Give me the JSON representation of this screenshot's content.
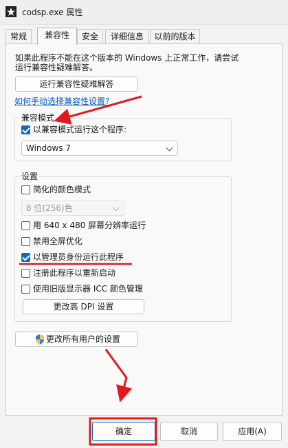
{
  "window": {
    "title": "codsp.exe 属性",
    "app_icon": "star-icon"
  },
  "tabs": [
    {
      "label": "常规"
    },
    {
      "label": "兼容性",
      "active": true
    },
    {
      "label": "安全"
    },
    {
      "label": "详细信息"
    },
    {
      "label": "以前的版本"
    }
  ],
  "intro": {
    "line1": "如果此程序不能在这个版本的 Windows 上正常工作，请尝试",
    "line2": "运行兼容性疑难解答。"
  },
  "troubleshooter_button": "运行兼容性疑难解答",
  "manual_link": "如何手动选择兼容性设置?",
  "compat_mode": {
    "group_label": "兼容模式",
    "checkbox_label": "以兼容模式运行这个程序:",
    "checked": true,
    "selected_os": "Windows 7"
  },
  "settings": {
    "group_label": "设置",
    "reduced_color": {
      "label": "简化的颜色模式",
      "checked": false
    },
    "color_select": "8 位(256)色",
    "res_640": {
      "label": "用 640 x 480 屏幕分辨率运行",
      "checked": false
    },
    "disable_fullscreen": {
      "label": "禁用全屏优化",
      "checked": false
    },
    "run_as_admin": {
      "label": "以管理员身份运行此程序",
      "checked": true
    },
    "register_restart": {
      "label": "注册此程序以重新启动",
      "checked": false
    },
    "legacy_icc": {
      "label": "使用旧版显示器 ICC 颜色管理",
      "checked": false
    },
    "dpi_button": "更改高 DPI 设置"
  },
  "all_users_button": "更改所有用户的设置",
  "all_users_icon": "shield-icon",
  "footer": {
    "ok": "确定",
    "cancel": "取消",
    "apply": "应用(A)"
  },
  "annotation_color": "#e0191c",
  "accent_color": "#0f6cbd"
}
